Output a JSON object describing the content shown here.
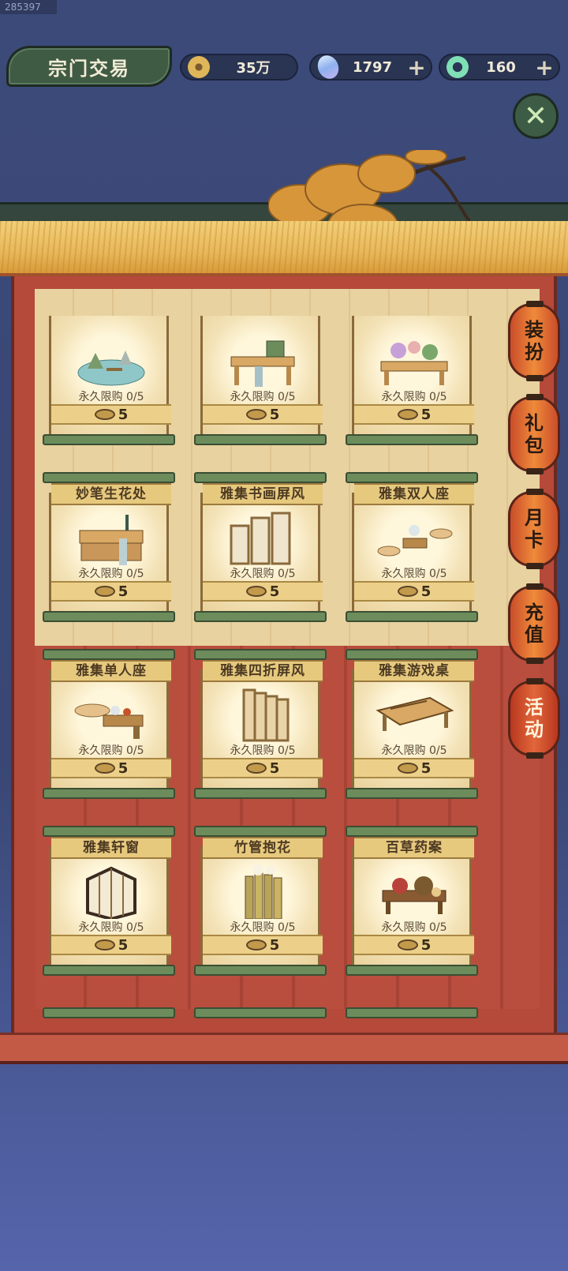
{
  "watermark_id": "285397",
  "header": {
    "title": "宗门交易",
    "coins": "35万",
    "gems": "1797",
    "jade": "160",
    "plus_label": "+",
    "close_label": "✕"
  },
  "side_tabs": [
    {
      "line1": "装",
      "line2": "扮"
    },
    {
      "line1": "礼",
      "line2": "包"
    },
    {
      "line1": "月",
      "line2": "卡"
    },
    {
      "line1": "充",
      "line2": "值"
    },
    {
      "line1": "活",
      "line2": "动"
    }
  ],
  "items": [
    {
      "name": "",
      "limit": "永久限购 0/5",
      "price": "5",
      "icon": "landscape-pond-icon"
    },
    {
      "name": "",
      "limit": "永久限购 0/5",
      "price": "5",
      "icon": "writing-desk-icon"
    },
    {
      "name": "",
      "limit": "永久限购 0/5",
      "price": "5",
      "icon": "flower-table-icon"
    },
    {
      "name": "妙笔生花处",
      "limit": "永久限购 0/5",
      "price": "5",
      "icon": "calligraphy-desk-icon"
    },
    {
      "name": "雅集书画屏风",
      "limit": "永久限购 0/5",
      "price": "5",
      "icon": "painting-screen-icon"
    },
    {
      "name": "雅集双人座",
      "limit": "永久限购 0/5",
      "price": "5",
      "icon": "double-seat-icon"
    },
    {
      "name": "雅集单人座",
      "limit": "永久限购 0/5",
      "price": "5",
      "icon": "single-seat-icon"
    },
    {
      "name": "雅集四折屏风",
      "limit": "永久限购 0/5",
      "price": "5",
      "icon": "folding-screen-icon"
    },
    {
      "name": "雅集游戏桌",
      "limit": "永久限购 0/5",
      "price": "5",
      "icon": "game-table-icon"
    },
    {
      "name": "雅集轩窗",
      "limit": "永久限购 0/5",
      "price": "5",
      "icon": "window-icon"
    },
    {
      "name": "竹管抱花",
      "limit": "永久限购 0/5",
      "price": "5",
      "icon": "bamboo-flower-icon"
    },
    {
      "name": "百草药案",
      "limit": "永久限购 0/5",
      "price": "5",
      "icon": "herb-table-icon"
    }
  ]
}
